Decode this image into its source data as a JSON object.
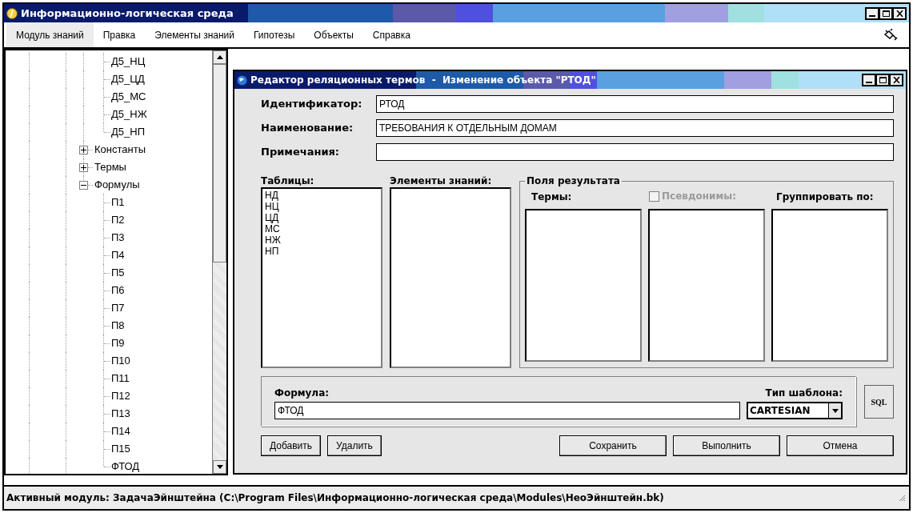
{
  "window": {
    "title": "Информационно-логическая среда"
  },
  "menu": [
    {
      "label": "Модуль знаний",
      "selected": true
    },
    {
      "label": "Правка",
      "selected": false
    },
    {
      "label": "Элементы знаний",
      "selected": false
    },
    {
      "label": "Гипотезы",
      "selected": false
    },
    {
      "label": "Объекты",
      "selected": false
    },
    {
      "label": "Справка",
      "selected": false
    }
  ],
  "tree": {
    "hidden_parent_children": [
      {
        "label": "Д5_НЦ"
      },
      {
        "label": "Д5_ЦД"
      },
      {
        "label": "Д5_МС"
      },
      {
        "label": "Д5_НЖ"
      },
      {
        "label": "Д5_НП"
      }
    ],
    "items": [
      {
        "label": "Константы",
        "expanded": false
      },
      {
        "label": "Термы",
        "expanded": false
      },
      {
        "label": "Формулы",
        "expanded": true,
        "children": [
          {
            "label": "П1"
          },
          {
            "label": "П2"
          },
          {
            "label": "П3"
          },
          {
            "label": "П4"
          },
          {
            "label": "П5"
          },
          {
            "label": "П6"
          },
          {
            "label": "П7"
          },
          {
            "label": "П8"
          },
          {
            "label": "П9"
          },
          {
            "label": "П10"
          },
          {
            "label": "П11"
          },
          {
            "label": "П12"
          },
          {
            "label": "П13"
          },
          {
            "label": "П14"
          },
          {
            "label": "П15"
          },
          {
            "label": "ФТОД"
          }
        ]
      }
    ]
  },
  "dialog": {
    "title_main": "Редактор реляционных термов  -  Изменение объекта",
    "title_object": "\"РТОД\"",
    "fields": [
      {
        "label": "Идентификатор:",
        "value": "РТОД"
      },
      {
        "label": "Наименование:",
        "value": "ТРЕБОВАНИЯ К ОТДЕЛЬНЫМ ДОМАМ"
      },
      {
        "label": "Примечания:"
      }
    ],
    "tables": {
      "label": "Таблицы:",
      "items": [
        "НД",
        "НЦ",
        "ЦД",
        "МС",
        "НЖ",
        "НП"
      ]
    },
    "knowledge_elements": {
      "label": "Элементы знаний:"
    },
    "result_fields": {
      "title": "Поля результата",
      "terms": {
        "label": "Термы:"
      },
      "aliases": {
        "label": "Псевдонимы:",
        "checked": false,
        "disabled": true
      },
      "group_by": {
        "label": "Группировать по:"
      }
    },
    "formula": {
      "label": "Формула:",
      "value": "ФТОД"
    },
    "template_type": {
      "label": "Тип шаблона:",
      "value": "CARTESIAN"
    },
    "sql_button": "SQL",
    "buttons_left": [
      "Добавить",
      "Удалить"
    ],
    "buttons_right": [
      "Сохранить",
      "Выполнить",
      "Отмена"
    ]
  },
  "status_bar": "Активный модуль: ЗадачаЭйнштейна (C:\\Program Files\\Информационно-логическая среда\\Modules\\НеоЭйнштейн.bk)"
}
